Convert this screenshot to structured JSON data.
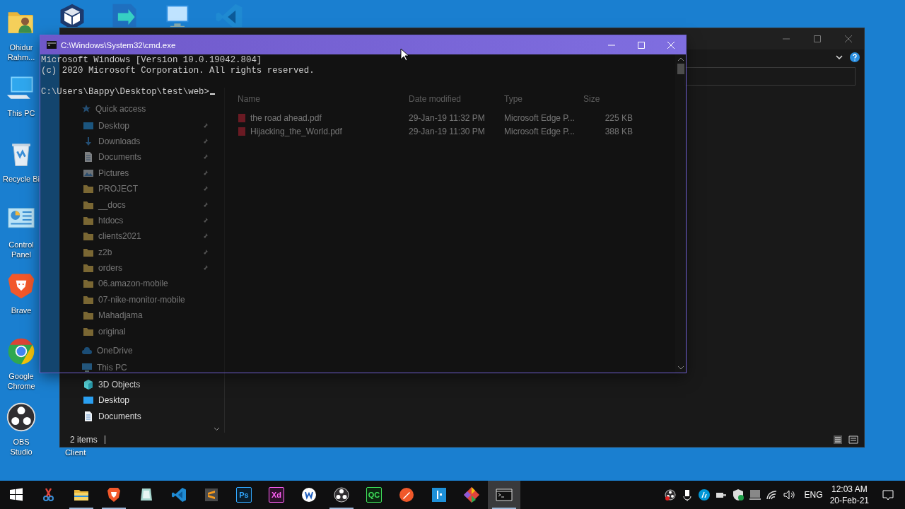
{
  "desktop_icons": [
    {
      "kind": "user-folder",
      "label": "Ohidur Rahm..."
    },
    {
      "kind": "pc",
      "label": "This PC"
    },
    {
      "kind": "recycle",
      "label": "Recycle Bi"
    },
    {
      "kind": "control-panel",
      "label": "Control Panel"
    },
    {
      "kind": "brave",
      "label": "Brave"
    },
    {
      "kind": "chrome",
      "label": "Google Chrome"
    },
    {
      "kind": "obs",
      "label": "OBS Studio"
    }
  ],
  "desktop_top_icons": [
    {
      "kind": "cube"
    },
    {
      "kind": "arrow-app"
    },
    {
      "kind": "remote"
    },
    {
      "kind": "vscode"
    }
  ],
  "hidden_icon_label": "Client",
  "explorer": {
    "nav": [
      {
        "label": "Quick access",
        "kind": "star",
        "children": [
          {
            "label": "Desktop",
            "kind": "desktop",
            "pinned": true
          },
          {
            "label": "Downloads",
            "kind": "downloads",
            "pinned": true
          },
          {
            "label": "Documents",
            "kind": "documents",
            "pinned": true
          },
          {
            "label": "Pictures",
            "kind": "pictures",
            "pinned": true
          },
          {
            "label": "PROJECT",
            "kind": "folder",
            "pinned": true
          },
          {
            "label": "__docs",
            "kind": "folder",
            "pinned": true
          },
          {
            "label": "htdocs",
            "kind": "folder",
            "pinned": true
          },
          {
            "label": "clients2021",
            "kind": "folder",
            "pinned": true
          },
          {
            "label": "z2b",
            "kind": "folder",
            "pinned": true
          },
          {
            "label": "orders",
            "kind": "folder",
            "pinned": true
          },
          {
            "label": "06.amazon-mobile",
            "kind": "folder",
            "pinned": false
          },
          {
            "label": "07-nike-monitor-mobile",
            "kind": "folder",
            "pinned": false
          },
          {
            "label": "Mahadjama",
            "kind": "folder",
            "pinned": false
          },
          {
            "label": "original",
            "kind": "folder",
            "pinned": false
          }
        ]
      },
      {
        "label": "OneDrive",
        "kind": "cloud"
      },
      {
        "label": "This PC",
        "kind": "pc",
        "children": [
          {
            "label": "3D Objects",
            "kind": "objects",
            "pinned": false
          },
          {
            "label": "Desktop",
            "kind": "desktop",
            "pinned": false
          },
          {
            "label": "Documents",
            "kind": "documents",
            "pinned": false
          }
        ]
      }
    ],
    "columns": [
      "Name",
      "Date modified",
      "Type",
      "Size"
    ],
    "files": [
      {
        "name": "the road ahead.pdf",
        "date": "29-Jan-19 11:32 PM",
        "type": "Microsoft Edge P...",
        "size": "225 KB"
      },
      {
        "name": "Hijacking_the_World.pdf",
        "date": "29-Jan-19 11:30 PM",
        "type": "Microsoft Edge P...",
        "size": "388 KB"
      }
    ],
    "status": "2 items"
  },
  "cmd": {
    "title": "C:\\Windows\\System32\\cmd.exe",
    "output": [
      "Microsoft Windows [Version 10.0.19042.804]",
      "(c) 2020 Microsoft Corporation. All rights reserved."
    ],
    "prompt": "C:\\Users\\Bappy\\Desktop\\test\\web>"
  },
  "taskbar": {
    "items": [
      {
        "kind": "start",
        "running": false,
        "active": false
      },
      {
        "kind": "snip",
        "running": false,
        "active": false
      },
      {
        "kind": "explorer",
        "running": true,
        "active": false
      },
      {
        "kind": "brave",
        "running": true,
        "active": false
      },
      {
        "kind": "notes",
        "running": false,
        "active": false
      },
      {
        "kind": "vscode",
        "running": false,
        "active": false
      },
      {
        "kind": "sublime",
        "running": false,
        "active": false
      },
      {
        "kind": "tile",
        "glyph": "Ps",
        "color": "#31a8ff",
        "running": false,
        "active": false
      },
      {
        "kind": "tile",
        "glyph": "Xd",
        "color": "#ff61f6",
        "running": false,
        "active": false
      },
      {
        "kind": "w",
        "running": false,
        "active": false
      },
      {
        "kind": "obs",
        "running": true,
        "active": false
      },
      {
        "kind": "tile",
        "glyph": "QC",
        "color": "#3fe05a",
        "running": false,
        "active": false
      },
      {
        "kind": "pen",
        "running": false,
        "active": false
      },
      {
        "kind": "box",
        "running": false,
        "active": false
      },
      {
        "kind": "git",
        "running": false,
        "active": false
      },
      {
        "kind": "terminal",
        "running": true,
        "active": true
      }
    ],
    "tray": [
      {
        "kind": "obs"
      },
      {
        "kind": "mic"
      },
      {
        "kind": "hp"
      },
      {
        "kind": "battery"
      },
      {
        "kind": "shield"
      },
      {
        "kind": "tablet"
      },
      {
        "kind": "wifi"
      },
      {
        "kind": "volume"
      }
    ],
    "language": "ENG",
    "time": "12:03 AM",
    "date": "20-Feb-21"
  }
}
